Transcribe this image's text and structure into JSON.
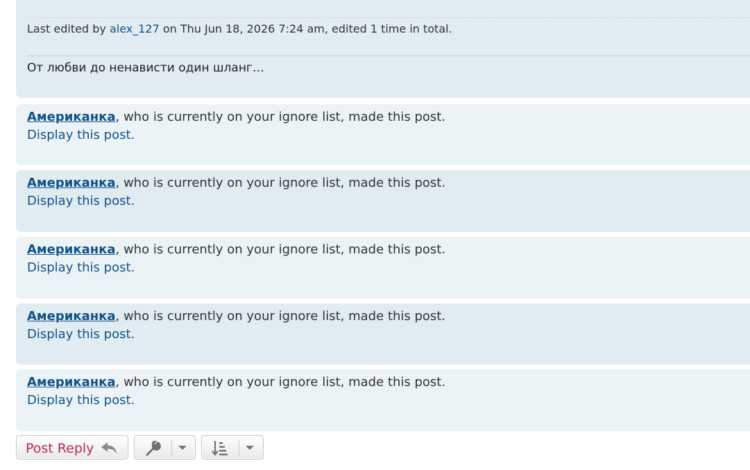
{
  "top_post": {
    "edit_prefix": "Last edited by ",
    "edit_user": "alex_127",
    "edit_suffix": " on Thu Jun 18, 2026 7:24 am, edited 1 time in total.",
    "signature": "От любви до ненависти один шланг…"
  },
  "ignored_posts": [
    {
      "user": "Американка",
      "message": ", who is currently on your ignore list, made this post.",
      "display_link": "Display this post",
      "period": "."
    },
    {
      "user": "Американка",
      "message": ", who is currently on your ignore list, made this post.",
      "display_link": "Display this post",
      "period": "."
    },
    {
      "user": "Американка",
      "message": ", who is currently on your ignore list, made this post.",
      "display_link": "Display this post",
      "period": "."
    },
    {
      "user": "Американка",
      "message": ", who is currently on your ignore list, made this post.",
      "display_link": "Display this post",
      "period": "."
    },
    {
      "user": "Американка",
      "message": ", who is currently on your ignore list, made this post.",
      "display_link": "Display this post",
      "period": "."
    }
  ],
  "action_bar": {
    "post_reply_label": "Post Reply",
    "reply_icon": "reply-icon",
    "tools_icon": "wrench-icon",
    "sort_icon": "sort-icon",
    "dropdown_icon": "caret-down-icon"
  },
  "colors": {
    "link": "#105289",
    "post_bg_light": "#ecf3f7",
    "post_bg_dark": "#e1ebf2",
    "reply_text": "#bc2a4d"
  }
}
